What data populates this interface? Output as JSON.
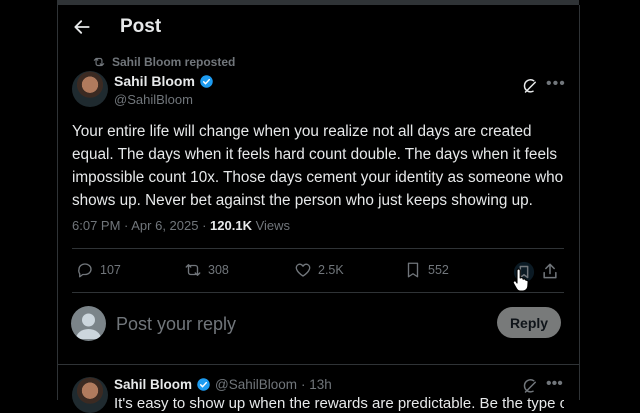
{
  "header": {
    "title": "Post"
  },
  "repost": {
    "label": "Sahil Bloom reposted"
  },
  "post": {
    "author_name": "Sahil Bloom",
    "author_handle": "@SahilBloom",
    "text": "Your entire life will change when you realize not all days are created equal. The days when it feels hard count double. The days when it feels impossible count 10x. Those days cement your identity as someone who shows up. Never bet against the person who just keeps showing up.",
    "time": "6:07 PM · Apr 6, 2025 · ",
    "views_count": "120.1K",
    "views_label": " Views",
    "replies": "107",
    "reposts": "308",
    "likes": "2.5K",
    "bookmarks": "552"
  },
  "reply_box": {
    "placeholder": "Post your reply",
    "button_label": "Reply"
  },
  "next_post": {
    "author_name": "Sahil Bloom",
    "author_handle": "@SahilBloom",
    "time": "· 13h",
    "text": "It's easy to show up when the rewards are predictable. Be the type of"
  },
  "colors": {
    "background": "#000000",
    "text": "#e7e9ea",
    "muted": "#71767b",
    "verified": "#1d9bf0",
    "border": "#2f3336"
  }
}
